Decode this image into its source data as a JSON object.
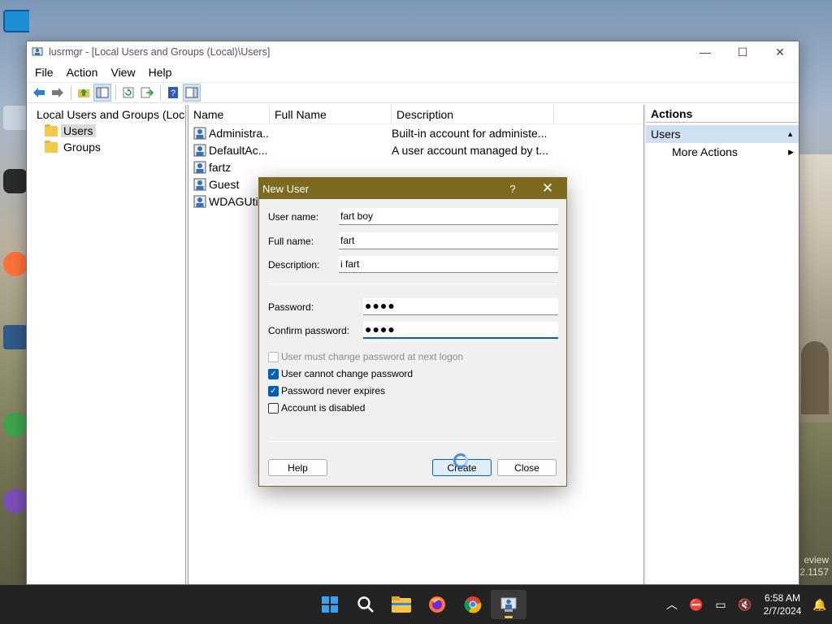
{
  "window": {
    "title": "lusrmgr - [Local Users and Groups (Local)\\Users]",
    "minimize": "—",
    "maximize": "☐",
    "close": "✕"
  },
  "menu": [
    "File",
    "Action",
    "View",
    "Help"
  ],
  "tree": {
    "root": "Local Users and Groups (Local)",
    "children": [
      "Users",
      "Groups"
    ],
    "selected": "Users"
  },
  "list": {
    "columns": [
      "Name",
      "Full Name",
      "Description"
    ],
    "rows": [
      {
        "name": "Administra...",
        "full": "",
        "desc": "Built-in account for administe..."
      },
      {
        "name": "DefaultAc...",
        "full": "",
        "desc": "A user account managed by t..."
      },
      {
        "name": "fartz",
        "full": "",
        "desc": ""
      },
      {
        "name": "Guest",
        "full": "",
        "desc": ""
      },
      {
        "name": "WDAGUtil",
        "full": "",
        "desc": ""
      }
    ]
  },
  "actions": {
    "header": "Actions",
    "section": "Users",
    "item": "More Actions"
  },
  "dialog": {
    "title": "New User",
    "help_glyph": "?",
    "close_glyph": "✕",
    "username_label": "User name:",
    "username_value": "fart boy",
    "fullname_label": "Full name:",
    "fullname_value": "fart",
    "description_label": "Description:",
    "description_value": "i fart",
    "password_label": "Password:",
    "password_value": "●●●●",
    "confirm_label": "Confirm password:",
    "confirm_value": "●●●●",
    "checkboxes": [
      {
        "label": "User must change password at next logon",
        "checked": false,
        "disabled": true
      },
      {
        "label": "User cannot change password",
        "checked": true,
        "disabled": false
      },
      {
        "label": "Password never expires",
        "checked": true,
        "disabled": false
      },
      {
        "label": "Account is disabled",
        "checked": false,
        "disabled": false
      }
    ],
    "help_button": "Help",
    "create_button": "Create",
    "close_button": "Close"
  },
  "desktop": {
    "watermark_line1": "eview",
    "watermark_line2": "2.1157"
  },
  "taskbar": {
    "time": "6:58 AM",
    "date": "2/7/2024",
    "icons": [
      "start-icon",
      "search-icon",
      "file-explorer-icon",
      "firefox-icon",
      "chrome-icon",
      "lusrmgr-icon"
    ]
  },
  "colors": {
    "dialog_title_bg": "#7b6a1f",
    "selection": "#cfe0f3",
    "accent": "#005fb8"
  }
}
